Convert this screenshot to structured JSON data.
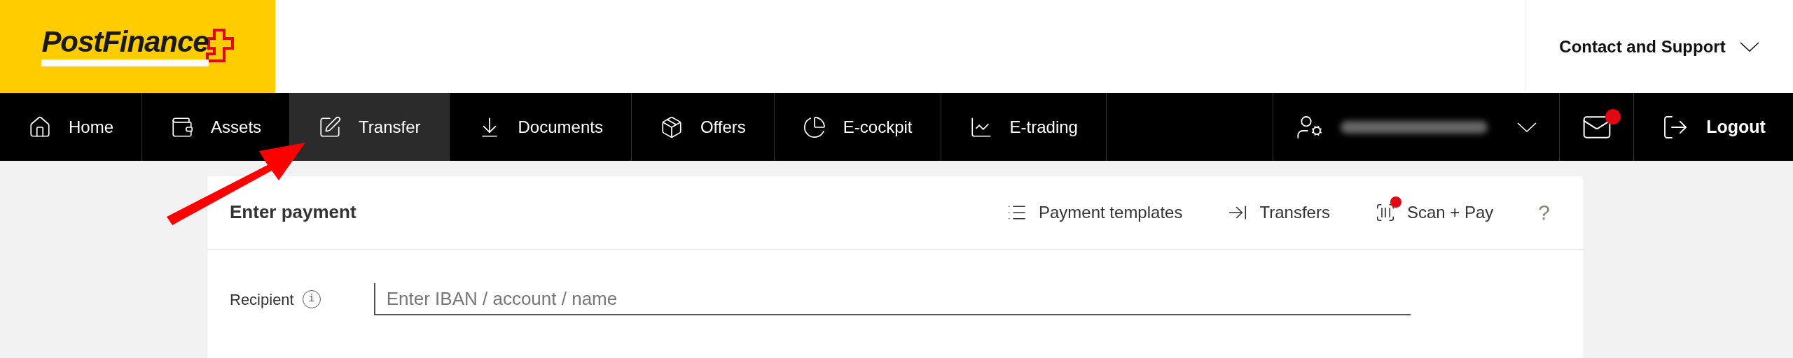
{
  "logo": {
    "text": "PostFinance"
  },
  "header": {
    "contact": "Contact and Support"
  },
  "nav": {
    "items": [
      {
        "label": "Home",
        "kind": "home",
        "selected": false
      },
      {
        "label": "Assets",
        "kind": "assets",
        "selected": false
      },
      {
        "label": "Transfer",
        "kind": "transfer",
        "selected": true
      },
      {
        "label": "Documents",
        "kind": "documents",
        "selected": false
      },
      {
        "label": "Offers",
        "kind": "offers",
        "selected": false
      },
      {
        "label": "E-cockpit",
        "kind": "cockpit",
        "selected": false
      },
      {
        "label": "E-trading",
        "kind": "trading",
        "selected": false
      }
    ],
    "mail_unread": true,
    "logout": "Logout"
  },
  "card": {
    "title": "Enter payment",
    "actions": [
      {
        "label": "Payment templates",
        "kind": "list",
        "badge": false
      },
      {
        "label": "Transfers",
        "kind": "transfers",
        "badge": false
      },
      {
        "label": "Scan + Pay",
        "kind": "scan",
        "badge": true
      }
    ],
    "help": "?",
    "recipient": {
      "label": "Recipient",
      "info": "i",
      "placeholder": "Enter IBAN / account / name"
    }
  }
}
